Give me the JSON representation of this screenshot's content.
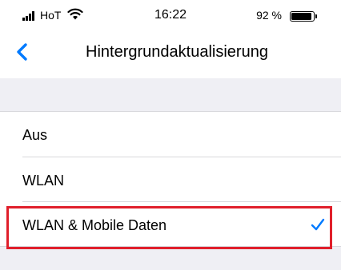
{
  "status_bar": {
    "carrier": "HoT",
    "time": "16:22",
    "battery_percent": "92 %",
    "battery_level": 0.92,
    "signal_icon": "signal-bars-icon",
    "wifi_icon": "wifi-icon",
    "battery_icon": "battery-icon"
  },
  "nav": {
    "back_icon": "chevron-left-icon",
    "title": "Hintergrundaktualisierung"
  },
  "options": [
    {
      "label": "Aus",
      "selected": false
    },
    {
      "label": "WLAN",
      "selected": false
    },
    {
      "label": "WLAN & Mobile Daten",
      "selected": true
    }
  ],
  "selected_icon": "checkmark-icon",
  "colors": {
    "accent": "#007aff",
    "highlight_box": "#e01f2b",
    "grouped_background": "#efeff4"
  }
}
